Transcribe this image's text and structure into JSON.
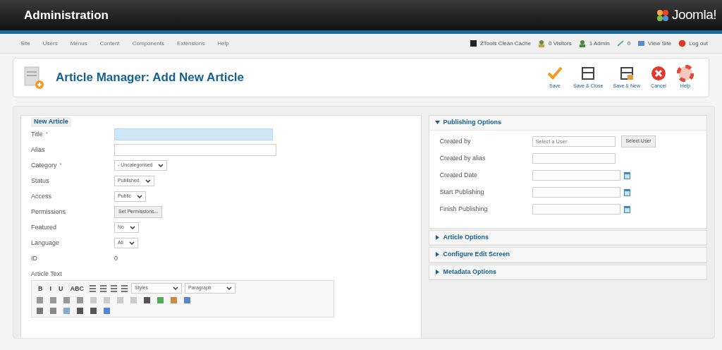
{
  "header": {
    "title": "Administration",
    "logo": "Joomla!"
  },
  "menu": [
    "Site",
    "Users",
    "Menus",
    "Content",
    "Components",
    "Extensions",
    "Help"
  ],
  "status": [
    {
      "kind": "cache",
      "label": "ZTools Clean Cache"
    },
    {
      "kind": "visitors",
      "label": "0 Visitors"
    },
    {
      "kind": "admin",
      "label": "1 Admin"
    },
    {
      "kind": "messages",
      "label": "0"
    },
    {
      "kind": "view",
      "label": "View Site"
    },
    {
      "kind": "logout",
      "label": "Log out"
    }
  ],
  "page_title": "Article Manager: Add New Article",
  "toolbar": [
    {
      "kind": "save",
      "label": "Save"
    },
    {
      "kind": "save-close",
      "label": "Save & Close"
    },
    {
      "kind": "save-new",
      "label": "Save & New"
    },
    {
      "kind": "cancel",
      "label": "Cancel"
    },
    {
      "kind": "help",
      "label": "Help"
    }
  ],
  "form": {
    "legend": "New Article",
    "required_mark": "*",
    "fields": [
      {
        "label": "Title",
        "required": true,
        "kind": "text",
        "focused": true
      },
      {
        "label": "Alias",
        "required": false,
        "kind": "text",
        "focused": false
      },
      {
        "label": "Category",
        "required": true,
        "kind": "select",
        "value": "- Uncategorised"
      },
      {
        "label": "Status",
        "required": false,
        "kind": "select",
        "value": "Published"
      },
      {
        "label": "Access",
        "required": false,
        "kind": "select",
        "value": "Public"
      },
      {
        "label": "Permissions",
        "required": false,
        "kind": "button",
        "value": "Set Permissions..."
      },
      {
        "label": "Featured",
        "required": false,
        "kind": "select",
        "value": "No"
      },
      {
        "label": "Language",
        "required": false,
        "kind": "select",
        "value": "All"
      },
      {
        "label": "ID",
        "required": false,
        "kind": "static",
        "value": "0"
      }
    ],
    "article_text_label": "Article Text",
    "editor": {
      "format_buttons": [
        "B",
        "I",
        "U",
        "ABC"
      ],
      "styles": "Styles",
      "block_format": "Paragraph"
    }
  },
  "panels": [
    {
      "title": "Publishing Options",
      "expanded": true,
      "fields": [
        {
          "label": "Created by",
          "kind": "user",
          "placeholder": "Select a User",
          "button": "Select User"
        },
        {
          "label": "Created by alias",
          "kind": "text"
        },
        {
          "label": "Created Date",
          "kind": "date"
        },
        {
          "label": "Start Publishing",
          "kind": "date"
        },
        {
          "label": "Finish Publishing",
          "kind": "date"
        }
      ]
    },
    {
      "title": "Article Options",
      "expanded": false
    },
    {
      "title": "Configure Edit Screen",
      "expanded": false
    },
    {
      "title": "Metadata Options",
      "expanded": false
    }
  ]
}
